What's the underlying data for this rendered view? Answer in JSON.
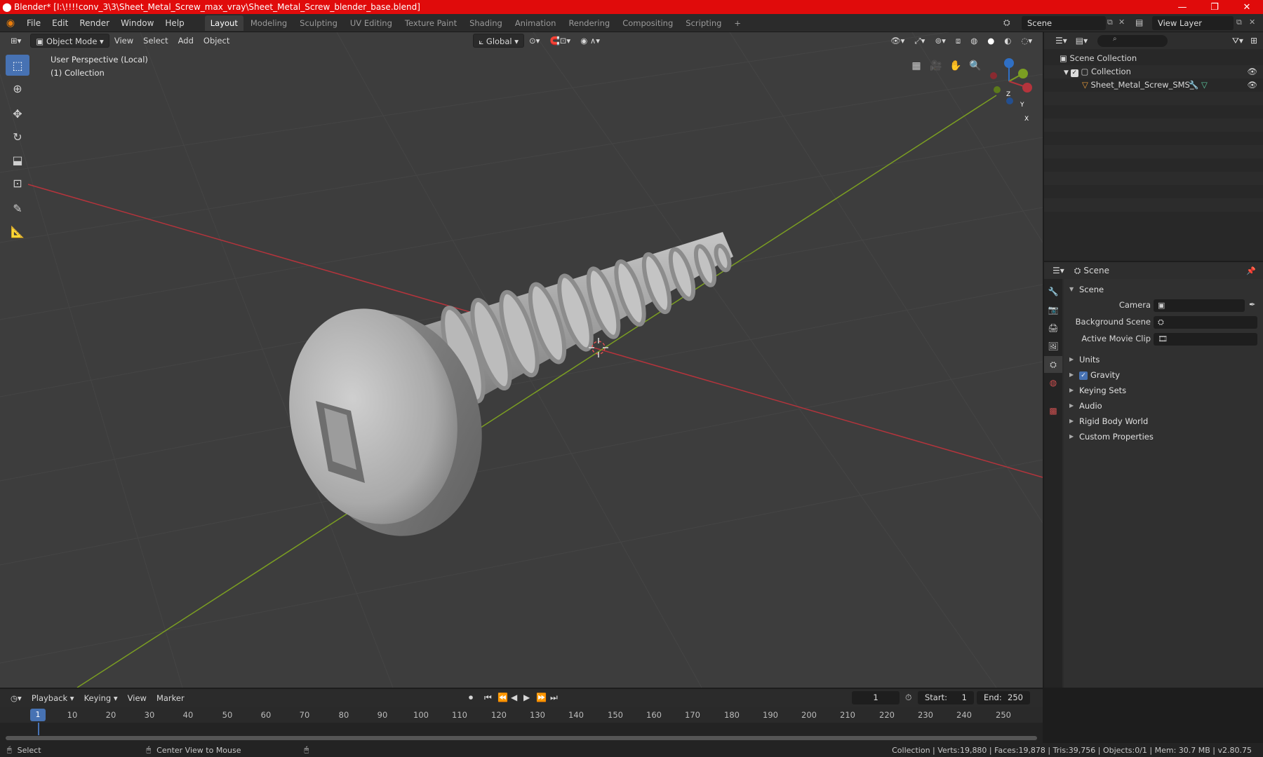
{
  "window": {
    "title": "Blender* [I:\\!!!!conv_3\\3\\Sheet_Metal_Screw_max_vray\\Sheet_Metal_Screw_blender_base.blend]",
    "controls": [
      "—",
      "❐",
      "✕"
    ]
  },
  "menu": [
    "File",
    "Edit",
    "Render",
    "Window",
    "Help"
  ],
  "workspaces": [
    "Layout",
    "Modeling",
    "Sculpting",
    "UV Editing",
    "Texture Paint",
    "Shading",
    "Animation",
    "Rendering",
    "Compositing",
    "Scripting"
  ],
  "workspace_active": "Layout",
  "add_workspace": "+",
  "scene_selector": {
    "value": "Scene"
  },
  "view_layer_selector": {
    "value": "View Layer"
  },
  "viewport": {
    "mode": "Object Mode",
    "menus": [
      "View",
      "Select",
      "Add",
      "Object"
    ],
    "transform_orientation": "Global",
    "overlay_line1": "User Perspective (Local)",
    "overlay_line2": "(1) Collection",
    "gizmo": {
      "z": "Z",
      "y": "Y",
      "x": "X"
    },
    "colors": {
      "x_axis": "#b5343c",
      "y_axis": "#7b9e22",
      "z_axis": "#2f6fc4",
      "active_tool": "#4772b3"
    }
  },
  "outliner": {
    "search_placeholder": "",
    "root": "Scene Collection",
    "collection": "Collection",
    "object": "Sheet_Metal_Screw_SMS_"
  },
  "properties": {
    "context": "Scene",
    "section": "Scene",
    "camera_label": "Camera",
    "background_scene_label": "Background Scene",
    "active_movie_clip_label": "Active Movie Clip",
    "panels": [
      "Units",
      "Gravity",
      "Keying Sets",
      "Audio",
      "Rigid Body World",
      "Custom Properties"
    ]
  },
  "timeline": {
    "menus": [
      "Playback",
      "Keying",
      "View",
      "Marker"
    ],
    "current_frame": "1",
    "start_label": "Start:",
    "start_value": "1",
    "end_label": "End:",
    "end_value": "250",
    "ticks": [
      "10",
      "20",
      "30",
      "40",
      "50",
      "60",
      "70",
      "80",
      "90",
      "100",
      "110",
      "120",
      "130",
      "140",
      "150",
      "160",
      "170",
      "180",
      "190",
      "200",
      "210",
      "220",
      "230",
      "240",
      "250"
    ],
    "playhead": "1"
  },
  "status": {
    "left_action": "Select",
    "mid_action": "Center View to Mouse",
    "stats": "Collection | Verts:19,880 | Faces:19,878 | Tris:39,756 | Objects:0/1 | Mem: 30.7 MB | v2.80.75"
  }
}
